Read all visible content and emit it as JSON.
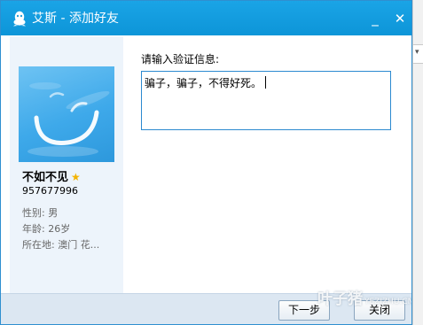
{
  "window": {
    "title": "艾斯 - 添加好友",
    "minimize_glyph": "_",
    "close_glyph": "✕"
  },
  "background_window": {
    "dropdown_glyph": "▾"
  },
  "profile": {
    "nickname": "不如不见",
    "star_glyph": "★",
    "qq_number": "957677996",
    "gender": "性别: 男",
    "age": "年龄: 26岁",
    "location": "所在地: 澳门  花..."
  },
  "verify": {
    "label": "请输入验证信息:",
    "message": "骗子，骗子，不得好死。"
  },
  "buttons": {
    "next_label": "下一步",
    "close_label": "关闭"
  },
  "watermark": {
    "main": "叶子猪",
    "sub": "YEZIZHU.CN"
  },
  "colors": {
    "titlebar": "#0d95d8",
    "panel": "#edf4fb",
    "footer": "#dce7f2",
    "accent_border": "#2c8ad0",
    "star": "#f3b300"
  },
  "icons": {
    "app_icon": "qq-penguin-icon",
    "star_icon": "star-icon",
    "minimize_icon": "minimize-icon",
    "close_icon": "close-icon"
  }
}
